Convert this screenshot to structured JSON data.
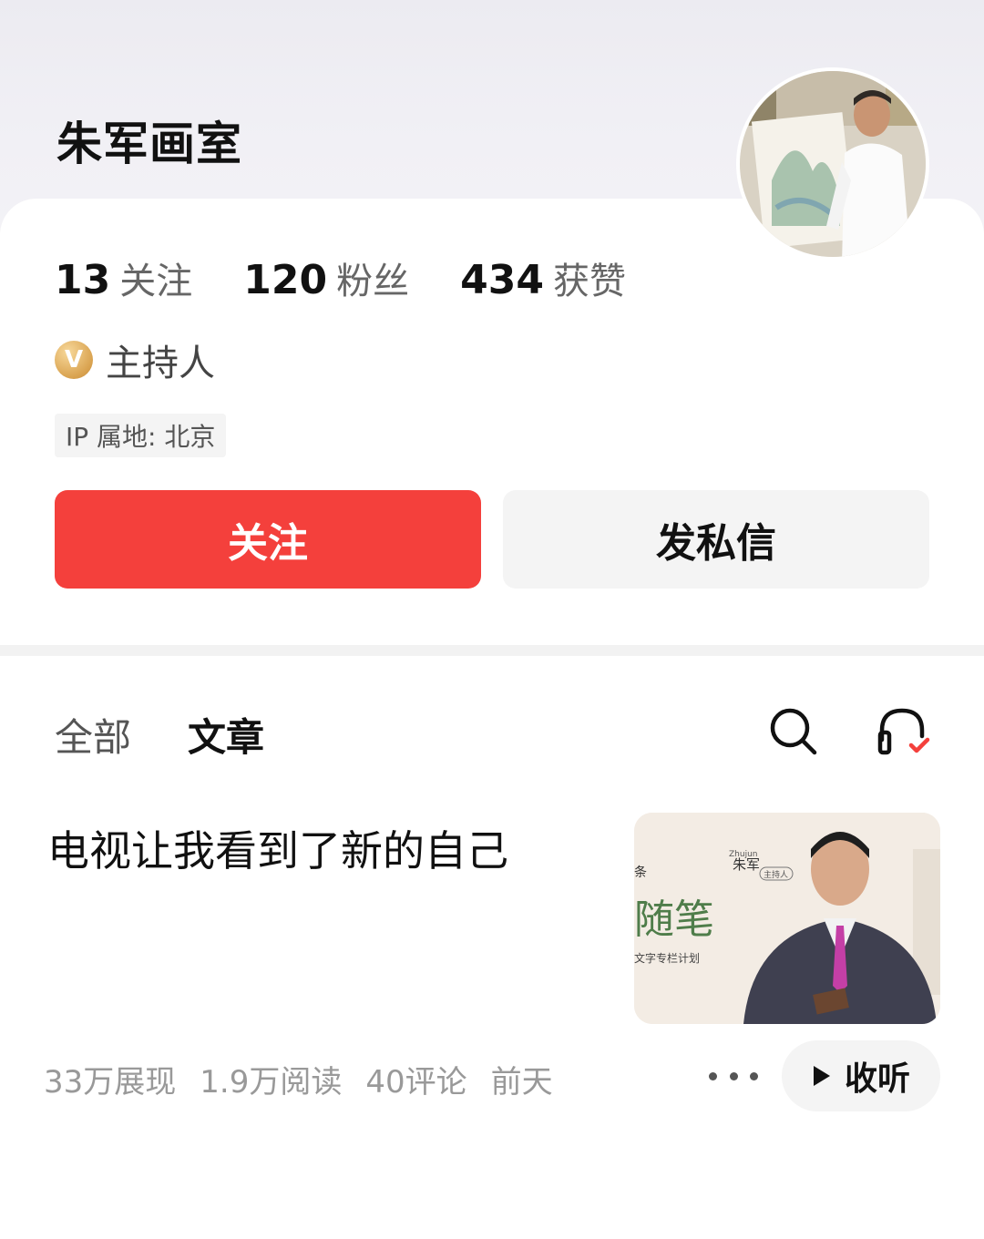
{
  "profile": {
    "name": "朱军画室",
    "stats": [
      {
        "value": "13",
        "label": "关注"
      },
      {
        "value": "120",
        "label": "粉丝"
      },
      {
        "value": "434",
        "label": "获赞"
      }
    ],
    "verified_badge": "V",
    "role": "主持人",
    "ip_location": "IP 属地: 北京",
    "follow_button": "关注",
    "message_button": "发私信",
    "badge_color": "#d9a24f",
    "follow_color": "#f4403c"
  },
  "tabs": [
    {
      "label": "全部",
      "active": false
    },
    {
      "label": "文章",
      "active": true
    }
  ],
  "toolbar": {
    "search_icon": "search-icon",
    "listen_icon": "headphones-check-icon"
  },
  "article": {
    "title": "电视让我看到了新的自己",
    "thumbnail_texts": {
      "corner": "条",
      "brand": "朱军",
      "brand_small": "Zhujun",
      "role_tag": "主持人",
      "calligraphy": "随笔",
      "subtitle": "文字专栏计划"
    },
    "meta": {
      "impressions": "33万展现",
      "reads": "1.9万阅读",
      "comments": "40评论",
      "time": "前天"
    },
    "more_icon": "more-dots-icon",
    "listen_button": "收听"
  }
}
